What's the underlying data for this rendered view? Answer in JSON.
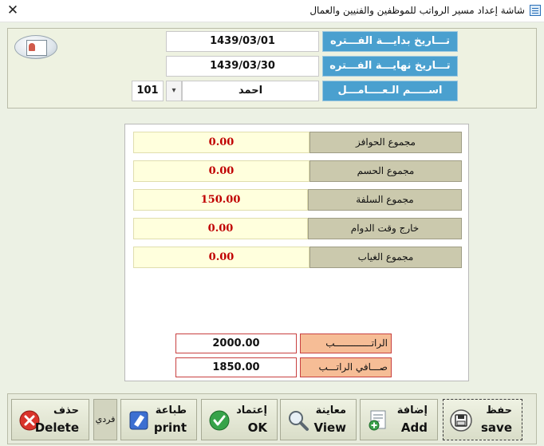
{
  "window": {
    "title": "شاشة إعداد مسير الرواتب للموظفين والفنيين والعمال",
    "close_glyph": "✕"
  },
  "header": {
    "period_start_label": "تـــاريخ بدايـــة الفـــتره",
    "period_start_value": "1439/03/01",
    "period_end_label": "تـــاريخ نهايـــة الفـــتره",
    "period_end_value": "1439/03/30",
    "worker_name_label": "اســـــم الـعــــامـــل",
    "worker_name_value": "احمد",
    "worker_id": "101",
    "dropdown_glyph": "▾",
    "label_color": "#4aa0cf"
  },
  "summary": {
    "rows": [
      {
        "label": "مجموع الحوافز",
        "value": "0.00"
      },
      {
        "label": "مجموع الحسم",
        "value": "0.00"
      },
      {
        "label": "مجموع السلفة",
        "value": "150.00"
      },
      {
        "label": "خارج وقت الدوام",
        "value": "0.00"
      },
      {
        "label": "مجموع الغياب",
        "value": "0.00"
      }
    ],
    "value_color": "#c00000"
  },
  "salary": {
    "salary_label": "الراتـــــــــــــب",
    "salary_value": "2000.00",
    "net_label": "صـــافي الراتـــب",
    "net_value": "1850.00"
  },
  "toolbar": {
    "delete": {
      "ar": "حذف",
      "en": "Delete",
      "icon": "delete-x-icon"
    },
    "individual": "فردي",
    "print": {
      "ar": "طباعة",
      "en": "print",
      "icon": "print-icon"
    },
    "approve": {
      "ar": "إعتماد",
      "en": "OK",
      "icon": "checkmark-icon"
    },
    "preview": {
      "ar": "معاينة",
      "en": "View",
      "icon": "magnifier-icon"
    },
    "add": {
      "ar": "إضافة",
      "en": "Add",
      "icon": "add-document-icon"
    },
    "save": {
      "ar": "حفظ",
      "en": "save",
      "icon": "floppy-disk-icon"
    }
  }
}
